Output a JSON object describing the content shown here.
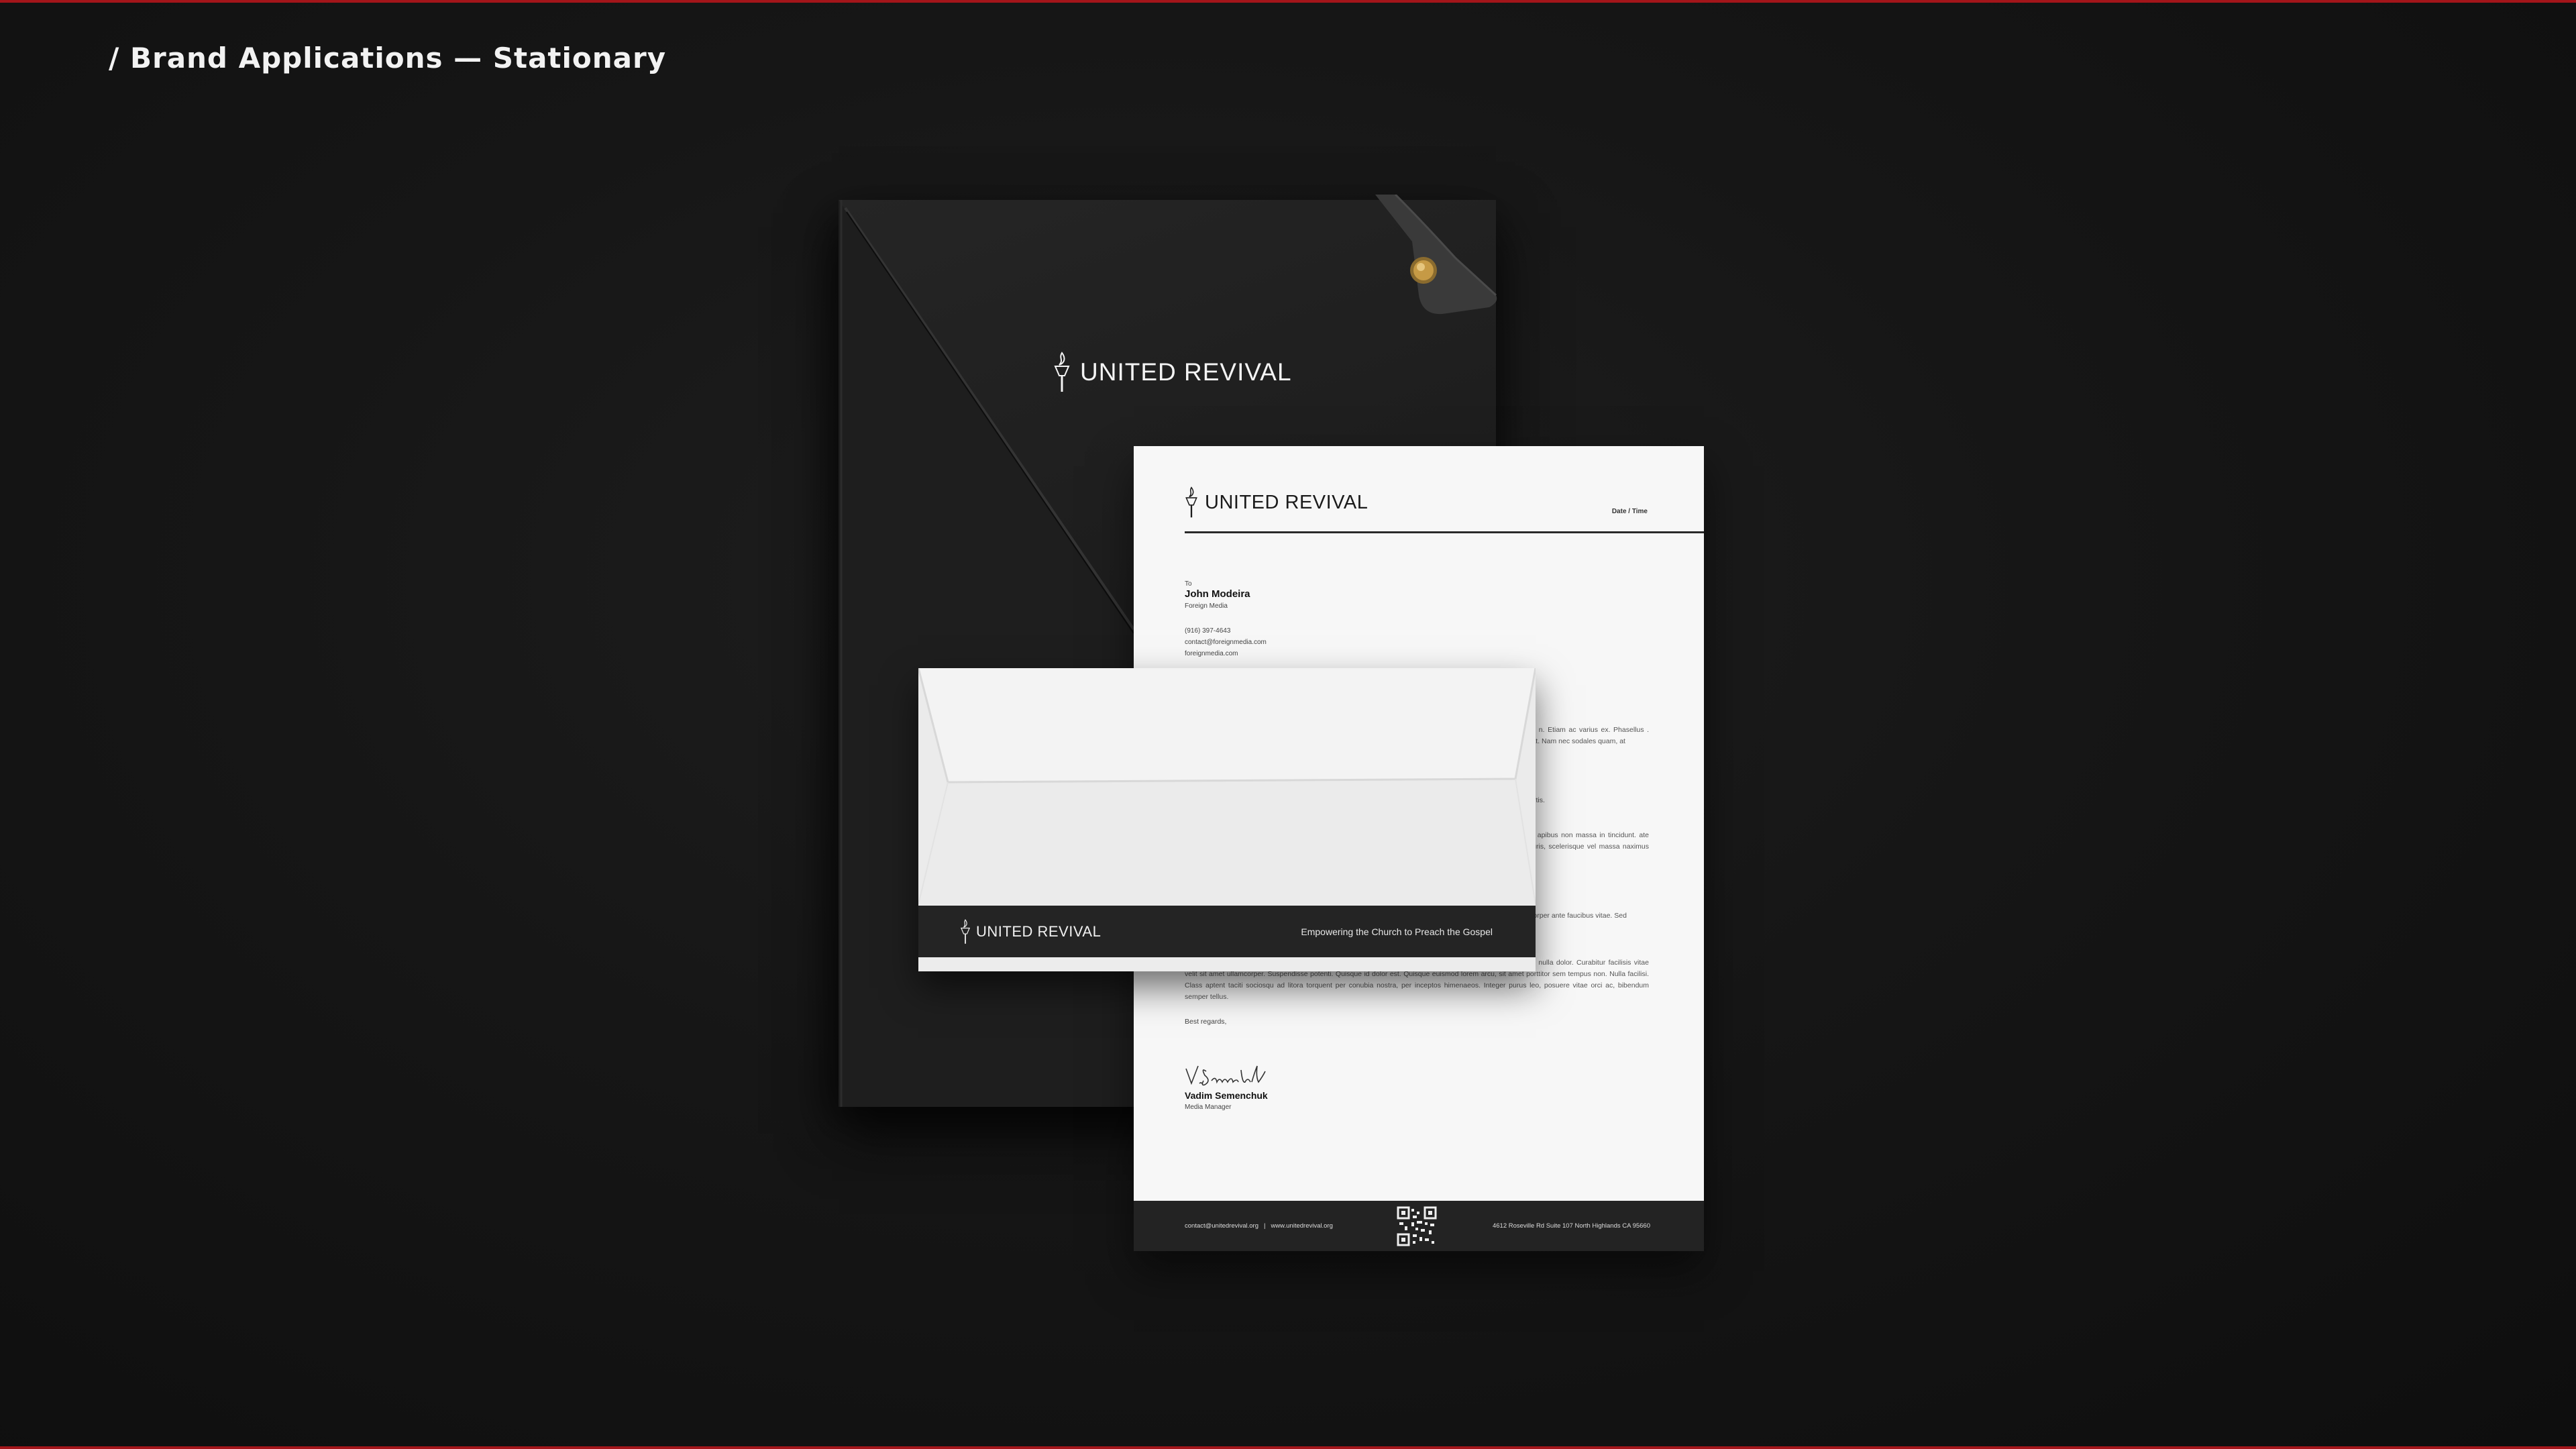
{
  "page": {
    "heading": "/ Brand Applications — Stationary",
    "accent_color": "#a3151a"
  },
  "folder": {
    "brand": "UNITED REVIVAL",
    "logo_icon": "torch-icon"
  },
  "letterhead": {
    "brand": "UNITED REVIVAL",
    "date_label": "Date / Time",
    "to_label": "To",
    "recipient_name": "John Modeira",
    "recipient_company": "Foreign Media",
    "recipient_phone": "(916) 397-4643",
    "recipient_email": "contact@foreignmedia.com",
    "recipient_website": "foreignmedia.com",
    "paragraphs": [
      "or non, tempus ac nulla. Donec n. Etiam ac varius ex. Phasellus . Vivamus ligula metus, sodales rat. Nam nec sodales quam, at",
      "o in urna interdum, id lobortis portis.",
      "honcus justo cursus non. Class apibus non massa in tincidunt. ate nec rutrum feugiat, congue mauris, scelerisque vel massa naximus neque diam, id feugiat",
      "on, molestie eu justo. Quisque corper ante faucibus vitae. Sed",
      "it venenatis lacus. Fusce iaculis nulla dolor. Curabitur facilisis vitae velit sit amet ullamcorper. Suspendisse potenti. Quisque id dolor est. Quisque euismod lorem arcu, sit amet porttitor sem tempus non. Nulla facilisi. Class aptent taciti sociosqu ad litora torquent per conubia nostra, per inceptos himenaeos. Integer purus leo, posuere vitae orci ac, bibendum semper tellus."
    ],
    "closing": "Best regards,",
    "signature_text": "V. Semenchuk",
    "signer_name": "Vadim Semenchuk",
    "signer_title": "Media Manager",
    "footer_email": "contact@unitedrevival.org",
    "footer_separator": "|",
    "footer_website": "www.unitedrevival.org",
    "footer_address": "4612 Roseville Rd Suite 107 North Highlands CA 95660"
  },
  "envelope": {
    "brand": "UNITED REVIVAL",
    "tagline": "Empowering the Church to Preach the Gospel"
  }
}
